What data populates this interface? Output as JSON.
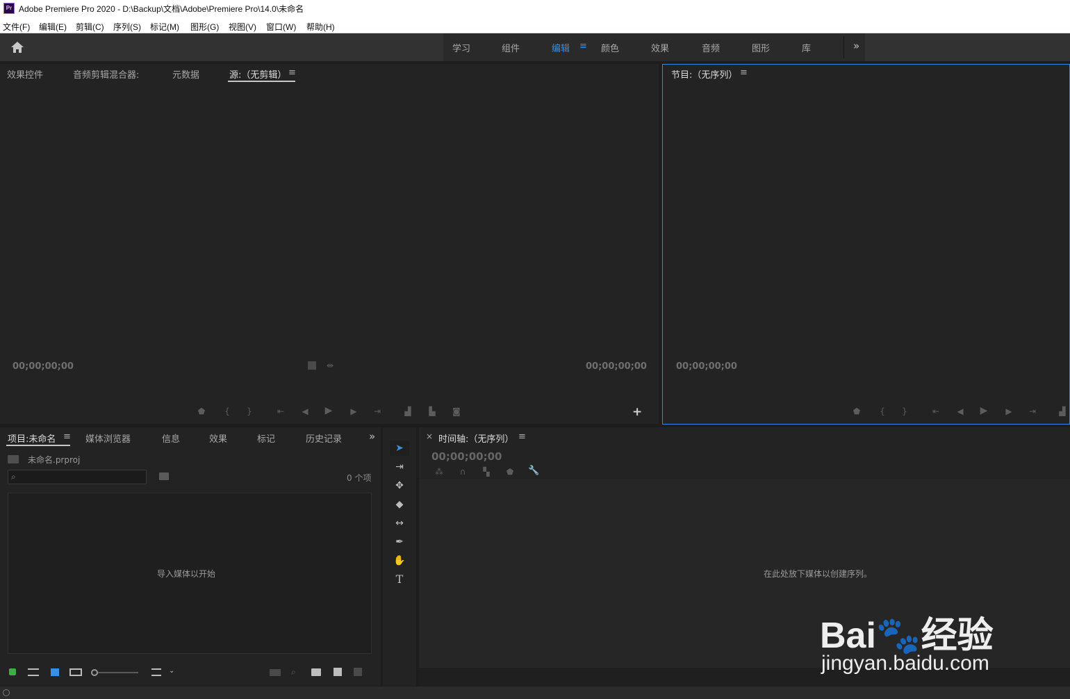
{
  "window": {
    "app_icon": "Pr",
    "title": "Adobe Premiere Pro 2020 - D:\\Backup\\文档\\Adobe\\Premiere Pro\\14.0\\未命名"
  },
  "menu": [
    "文件(F)",
    "编辑(E)",
    "剪辑(C)",
    "序列(S)",
    "标记(M)",
    "图形(G)",
    "视图(V)",
    "窗口(W)",
    "帮助(H)"
  ],
  "workspaces": {
    "tabs": [
      "学习",
      "组件",
      "编辑",
      "颜色",
      "效果",
      "音频",
      "图形",
      "库"
    ],
    "active": "编辑",
    "menu_icon": "≡",
    "more": "»"
  },
  "source_panel": {
    "tabs": [
      "效果控件",
      "音频剪辑混合器:",
      "元数据",
      "源:（无剪辑）"
    ],
    "menu_icon": "≡",
    "timecode_left": "00;00;00;00",
    "timecode_right": "00;00;00;00",
    "add_button": "+"
  },
  "program_panel": {
    "title": "节目:（无序列）",
    "menu_icon": "≡",
    "timecode": "00;00;00;00"
  },
  "project_panel": {
    "tabs": [
      "项目:未命名",
      "媒体浏览器",
      "信息",
      "效果",
      "标记",
      "历史记录"
    ],
    "menu_icon": "≡",
    "more": "»",
    "project_file": "未命名.prproj",
    "item_count": "0 个项",
    "empty_message": "导入媒体以开始"
  },
  "timeline_panel": {
    "close": "×",
    "title": "时间轴:（无序列）",
    "menu_icon": "≡",
    "timecode": "00;00;00;00",
    "empty_message": "在此处放下媒体以创建序列。"
  },
  "watermark": {
    "brand": "Bai🐾经验",
    "url": "jingyan.baidu.com"
  },
  "colors": {
    "accent": "#3b8ee0",
    "panel_bg": "#232323",
    "active_border": "#2d8ceb"
  }
}
